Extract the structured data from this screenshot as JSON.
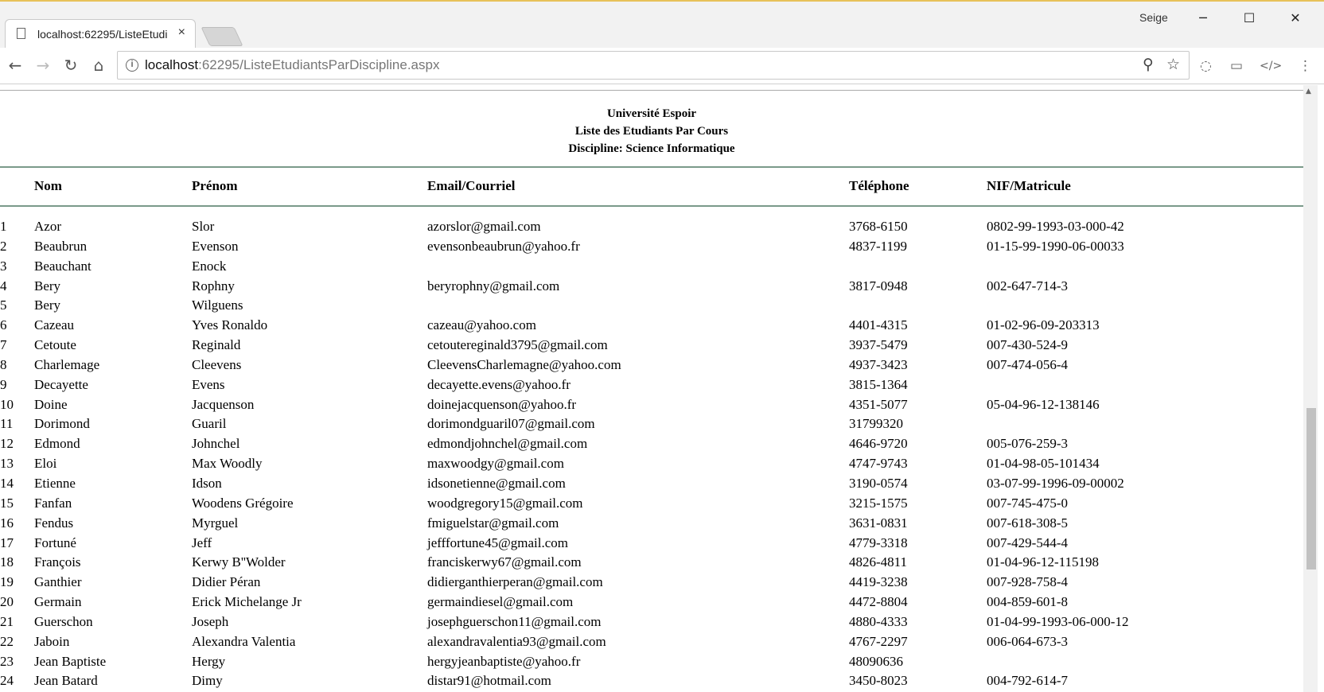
{
  "browser": {
    "tab_title": "localhost:62295/ListeEtudi",
    "tab_close": "×",
    "user_label": "Seige",
    "url_host": "localhost",
    "url_path": ":62295/ListeEtudiantsParDiscipline.aspx",
    "icons": {
      "back": "←",
      "forward": "→",
      "reload": "↻",
      "home": "⌂",
      "zoom": "⚲",
      "star": "☆",
      "ext1": "◌",
      "cast": "▭",
      "code": "</>",
      "menu": "⋮",
      "minimize": "─",
      "maximize": "☐",
      "close": "✕",
      "info": "i"
    }
  },
  "report": {
    "university": "Université Espoir",
    "subtitle": "Liste des Etudiants Par Cours",
    "discipline": "Discipline: Science Informatique"
  },
  "table": {
    "headers": {
      "nom": "Nom",
      "prenom": "Prénom",
      "email": "Email/Courriel",
      "tel": "Téléphone",
      "nif": "NIF/Matricule"
    },
    "rows": [
      {
        "n": "1",
        "nom": "Azor",
        "prenom": "Slor",
        "email": "azorslor@gmail.com",
        "tel": "3768-6150",
        "nif": "0802-99-1993-03-000-42"
      },
      {
        "n": "2",
        "nom": "Beaubrun",
        "prenom": "Evenson",
        "email": "evensonbeaubrun@yahoo.fr",
        "tel": "4837-1199",
        "nif": "01-15-99-1990-06-00033"
      },
      {
        "n": "3",
        "nom": "Beauchant",
        "prenom": "Enock",
        "email": "",
        "tel": "",
        "nif": ""
      },
      {
        "n": "4",
        "nom": "Bery",
        "prenom": "Rophny",
        "email": "beryrophny@gmail.com",
        "tel": "3817-0948",
        "nif": "002-647-714-3"
      },
      {
        "n": "5",
        "nom": "Bery",
        "prenom": "Wilguens",
        "email": "",
        "tel": "",
        "nif": ""
      },
      {
        "n": "6",
        "nom": "Cazeau",
        "prenom": "Yves Ronaldo",
        "email": "cazeau@yahoo.com",
        "tel": "4401-4315",
        "nif": "01-02-96-09-203313"
      },
      {
        "n": "7",
        "nom": "Cetoute",
        "prenom": "Reginald",
        "email": "cetoutereginald3795@gmail.com",
        "tel": "3937-5479",
        "nif": "007-430-524-9"
      },
      {
        "n": "8",
        "nom": "Charlemage",
        "prenom": "Cleevens",
        "email": "CleevensCharlemagne@yahoo.com",
        "tel": "4937-3423",
        "nif": "007-474-056-4"
      },
      {
        "n": "9",
        "nom": "Decayette",
        "prenom": "Evens",
        "email": "decayette.evens@yahoo.fr",
        "tel": "3815-1364",
        "nif": ""
      },
      {
        "n": "10",
        "nom": "Doine",
        "prenom": "Jacquenson",
        "email": "doinejacquenson@yahoo.fr",
        "tel": "4351-5077",
        "nif": "05-04-96-12-138146"
      },
      {
        "n": "11",
        "nom": "Dorimond",
        "prenom": "Guaril",
        "email": "dorimondguaril07@gmail.com",
        "tel": "31799320",
        "nif": ""
      },
      {
        "n": "12",
        "nom": "Edmond",
        "prenom": "Johnchel",
        "email": "edmondjohnchel@gmail.com",
        "tel": "4646-9720",
        "nif": "005-076-259-3"
      },
      {
        "n": "13",
        "nom": "Eloi",
        "prenom": "Max Woodly",
        "email": "maxwoodgy@gmail.com",
        "tel": "4747-9743",
        "nif": "01-04-98-05-101434"
      },
      {
        "n": "14",
        "nom": "Etienne",
        "prenom": "Idson",
        "email": "idsonetienne@gmail.com",
        "tel": "3190-0574",
        "nif": "03-07-99-1996-09-00002"
      },
      {
        "n": "15",
        "nom": "Fanfan",
        "prenom": "Woodens Grégoire",
        "email": "woodgregory15@gmail.com",
        "tel": "3215-1575",
        "nif": "007-745-475-0"
      },
      {
        "n": "16",
        "nom": "Fendus",
        "prenom": "Myrguel",
        "email": "fmiguelstar@gmail.com",
        "tel": "3631-0831",
        "nif": "007-618-308-5"
      },
      {
        "n": "17",
        "nom": "Fortuné",
        "prenom": "Jeff",
        "email": "jefffortune45@gmail.com",
        "tel": "4779-3318",
        "nif": "007-429-544-4"
      },
      {
        "n": "18",
        "nom": "François",
        "prenom": "Kerwy B''Wolder",
        "email": "franciskerwy67@gmail.com",
        "tel": "4826-4811",
        "nif": "01-04-96-12-115198"
      },
      {
        "n": "19",
        "nom": "Ganthier",
        "prenom": "Didier Péran",
        "email": "didierganthierperan@gmail.com",
        "tel": "4419-3238",
        "nif": "007-928-758-4"
      },
      {
        "n": "20",
        "nom": "Germain",
        "prenom": "Erick Michelange Jr",
        "email": "germaindiesel@gmail.com",
        "tel": "4472-8804",
        "nif": "004-859-601-8"
      },
      {
        "n": "21",
        "nom": "Guerschon",
        "prenom": "Joseph",
        "email": "josephguerschon11@gmail.com",
        "tel": "4880-4333",
        "nif": "01-04-99-1993-06-000-12"
      },
      {
        "n": "22",
        "nom": "Jaboin",
        "prenom": "Alexandra Valentia",
        "email": "alexandravalentia93@gmail.com",
        "tel": "4767-2297",
        "nif": "006-064-673-3"
      },
      {
        "n": "23",
        "nom": "Jean Baptiste",
        "prenom": "Hergy",
        "email": "hergyjeanbaptiste@yahoo.fr",
        "tel": "48090636",
        "nif": ""
      },
      {
        "n": "24",
        "nom": "Jean Batard",
        "prenom": "Dimy",
        "email": "distar91@hotmail.com",
        "tel": "3450-8023",
        "nif": "004-792-614-7"
      }
    ]
  }
}
